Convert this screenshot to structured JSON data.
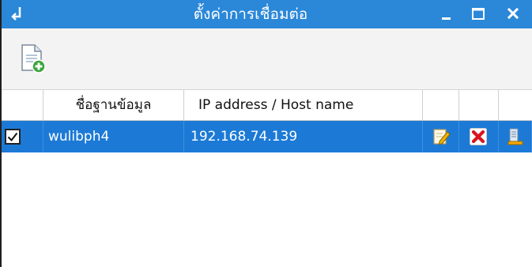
{
  "window": {
    "title": "ตั้งค่าการเชื่อมต่อ",
    "controls": {
      "minimize": "minimize",
      "maximize": "maximize",
      "close": "close"
    },
    "colors": {
      "titlebar": "#2b88d8",
      "selected_row": "#1c7ad6"
    }
  },
  "toolbar": {
    "add_icon": "add-connection-icon"
  },
  "table": {
    "columns": [
      "",
      "ชื่อฐานข้อมูล",
      "IP address / Host name",
      "",
      "",
      ""
    ],
    "rows": [
      {
        "checked": true,
        "database": "wulibph4",
        "host": "192.168.74.139",
        "actions": [
          "edit-icon",
          "delete-icon",
          "database-icon"
        ]
      }
    ]
  }
}
